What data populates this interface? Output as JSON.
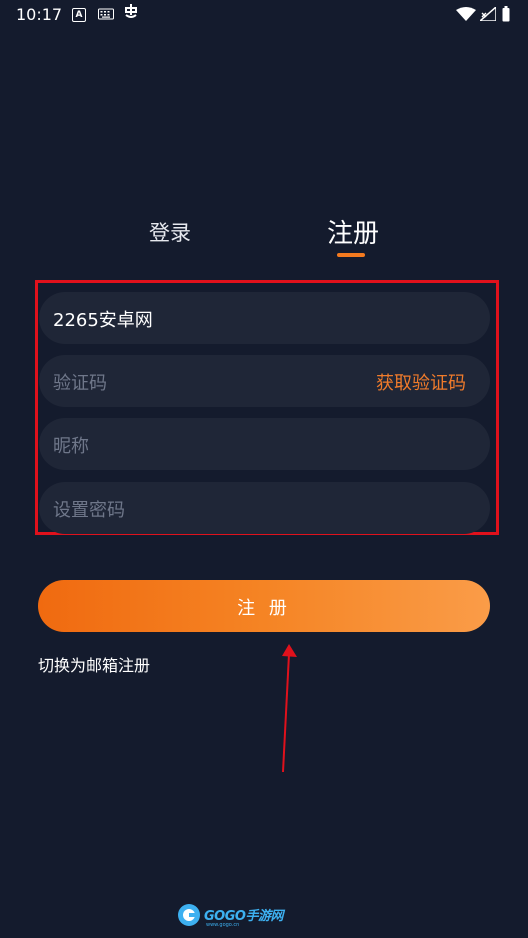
{
  "status_bar": {
    "time": "10:17",
    "icons": [
      "a-app-icon",
      "keyboard-icon",
      "bug-icon",
      "wifi-icon",
      "signal-icon",
      "battery-icon"
    ]
  },
  "tabs": {
    "login": "登录",
    "register": "注册",
    "active": "register"
  },
  "form": {
    "username_value": "2265安卓网",
    "code_placeholder": "验证码",
    "get_code_label": "获取验证码",
    "nickname_placeholder": "昵称",
    "password_placeholder": "设置密码"
  },
  "register_button": "注 册",
  "switch_link": "切换为邮箱注册",
  "watermark": {
    "text": "GOGO手游网",
    "sub": "www.gogo.cn"
  },
  "colors": {
    "background": "#141b2d",
    "accent": "#f47a1f",
    "annotation": "#e0111c"
  }
}
